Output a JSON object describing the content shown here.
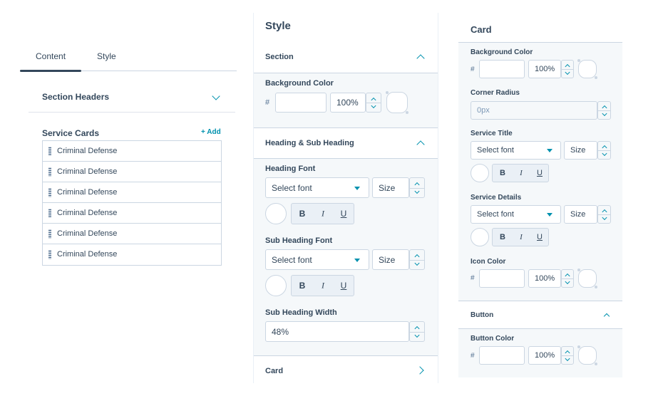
{
  "content_panel": {
    "tabs": [
      {
        "label": "Content"
      },
      {
        "label": "Style"
      }
    ],
    "section_headers": {
      "label": "Section Headers"
    },
    "service_cards": {
      "label": "Service Cards",
      "add_label": "+ Add",
      "items": [
        {
          "label": "Criminal Defense"
        },
        {
          "label": "Criminal Defense"
        },
        {
          "label": "Criminal Defense"
        },
        {
          "label": "Criminal Defense"
        },
        {
          "label": "Criminal Defense"
        },
        {
          "label": "Criminal Defense"
        }
      ]
    }
  },
  "style_panel": {
    "title": "Style",
    "section": {
      "label": "Section",
      "background_color": {
        "label": "Background Color",
        "hash": "#",
        "hex": "",
        "opacity": "100%"
      }
    },
    "heading": {
      "label": "Heading & Sub Heading",
      "heading_font": {
        "label": "Heading Font",
        "font_placeholder": "Select font",
        "size_placeholder": "Size",
        "bold": "B",
        "italic": "I",
        "underline": "U"
      },
      "sub_heading_font": {
        "label": "Sub Heading Font",
        "font_placeholder": "Select font",
        "size_placeholder": "Size",
        "bold": "B",
        "italic": "I",
        "underline": "U"
      },
      "sub_heading_width": {
        "label": "Sub Heading Width",
        "value": "48%"
      }
    },
    "card": {
      "label": "Card"
    }
  },
  "card_panel": {
    "title": "Card",
    "background_color": {
      "label": "Background Color",
      "hash": "#",
      "hex": "",
      "opacity": "100%"
    },
    "corner_radius": {
      "label": "Corner Radius",
      "placeholder": "0px"
    },
    "service_title": {
      "label": "Service Title",
      "font_placeholder": "Select font",
      "size_placeholder": "Size",
      "bold": "B",
      "italic": "I",
      "underline": "U"
    },
    "service_details": {
      "label": "Service Details",
      "font_placeholder": "Select font",
      "size_placeholder": "Size",
      "bold": "B",
      "italic": "I",
      "underline": "U"
    },
    "icon_color": {
      "label": "Icon Color",
      "hash": "#",
      "hex": "",
      "opacity": "100%"
    },
    "button": {
      "label": "Button"
    },
    "button_color": {
      "label": "Button Color",
      "hash": "#",
      "hex": "",
      "opacity": "100%"
    }
  },
  "colors": {
    "accent": "#0091ae",
    "text": "#33475b",
    "border": "#cbd6e2",
    "panel_bg": "#f5f8fa"
  }
}
